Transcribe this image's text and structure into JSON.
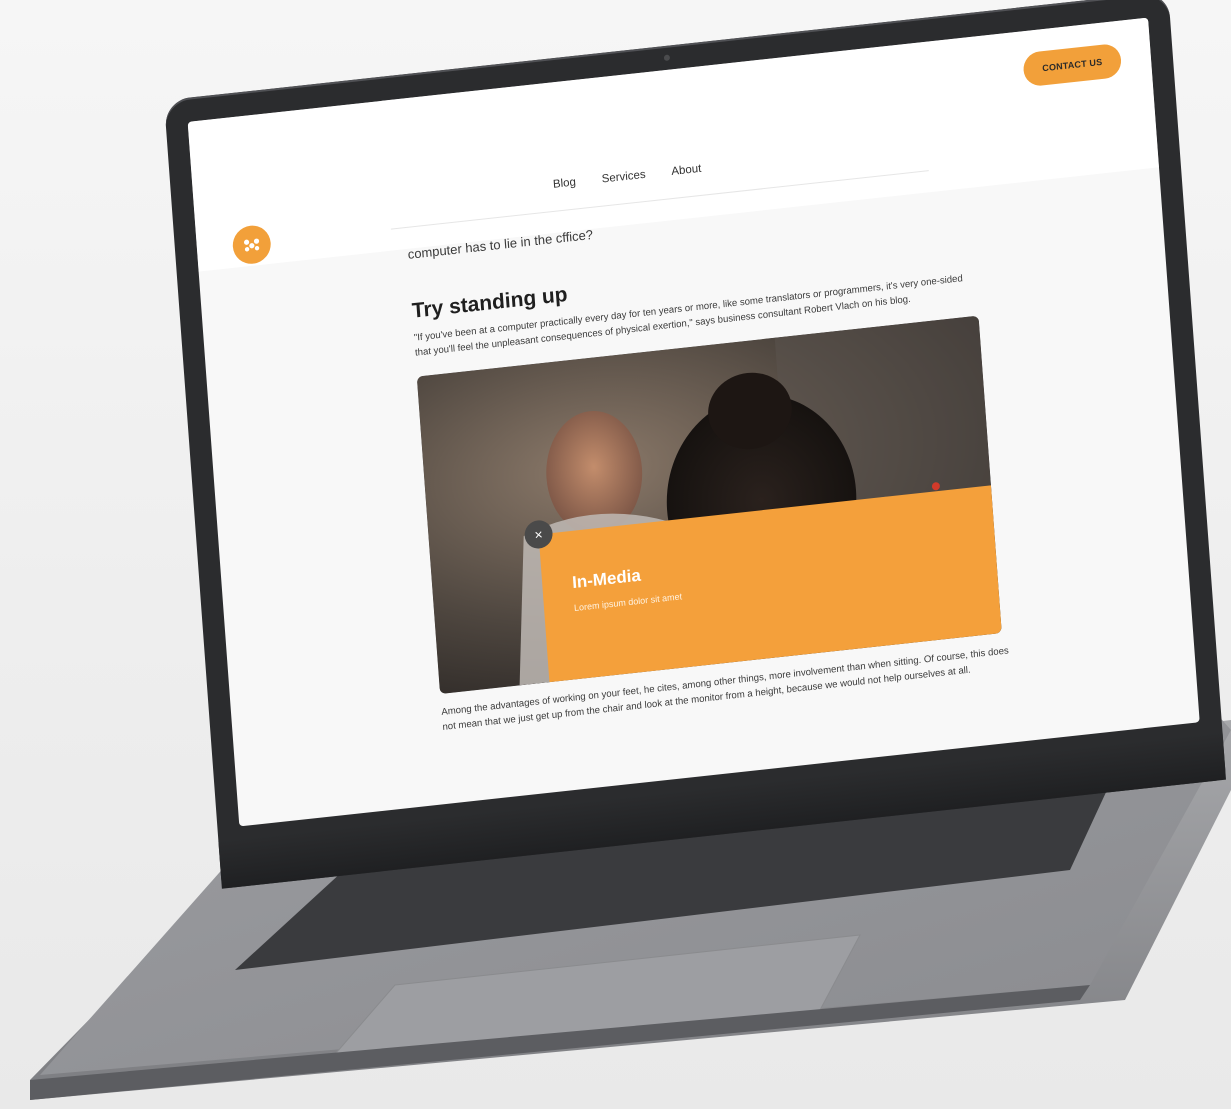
{
  "header": {
    "contact_label": "CONTACT US",
    "nav": [
      "Blog",
      "Services",
      "About"
    ]
  },
  "article": {
    "lead_question": "computer has to lie in the cffice?",
    "heading": "Try standing up",
    "quote": "\"If you've been at a computer practically every day for ten years or more, like some translators or programmers, it's very one-sided that you'll feel the unpleasant consequences of physical exertion,\" says business consultant Robert Vlach on his blog.",
    "body": "Among the advantages of working on your feet, he cites, among other things, more involvement than when sitting. Of course, this does not mean that we just get up from the chair and look at the monitor from a height, because we would not help ourselves at all."
  },
  "media_card": {
    "title": "In-Media",
    "subtitle": "Lorem ipsum dolor sit amet",
    "close_glyph": "×"
  },
  "colors": {
    "accent": "#f2a03a",
    "bezel": "#2b2c2e",
    "laptop_body": "#8f9094"
  },
  "icons": {
    "logo": "brand-logo-icon",
    "close": "close-icon"
  }
}
